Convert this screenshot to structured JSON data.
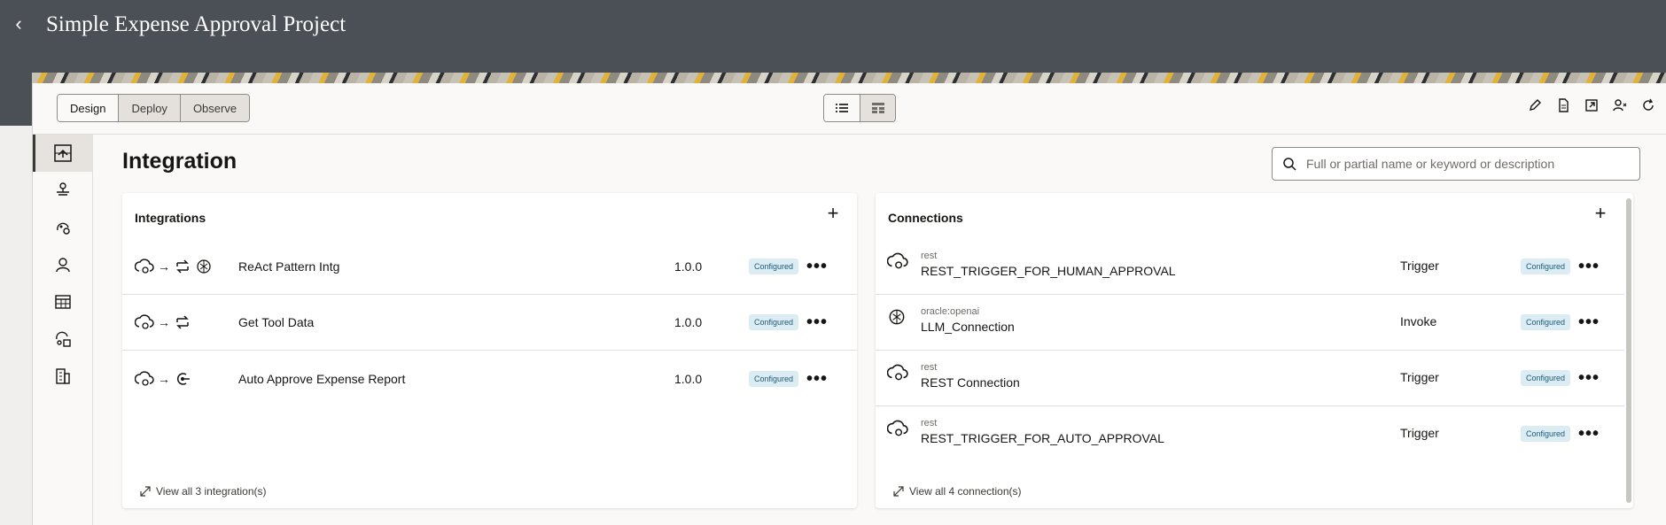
{
  "header": {
    "title": "Simple Expense Approval Project",
    "back_label": "‹"
  },
  "toolbar": {
    "modes": [
      "Design",
      "Deploy",
      "Observe"
    ],
    "active_mode": "Design",
    "view_icons": [
      "list-view-icon",
      "grid-view-icon"
    ],
    "actions": [
      "edit-icon",
      "document-icon",
      "export-icon",
      "share-icon",
      "refresh-icon"
    ]
  },
  "rail": {
    "items": [
      "integration-icon",
      "deploy-icon",
      "agent-icon",
      "user-icon",
      "table-icon",
      "tool-icon",
      "building-icon"
    ]
  },
  "main": {
    "title": "Integration",
    "search_placeholder": "Full or partial name or keyword or description"
  },
  "integrations": {
    "title": "Integrations",
    "add_label": "+",
    "rows": [
      {
        "name": "ReAct Pattern Intg",
        "version": "1.0.0",
        "status": "Configured"
      },
      {
        "name": "Get Tool Data",
        "version": "1.0.0",
        "status": "Configured"
      },
      {
        "name": "Auto Approve Expense Report",
        "version": "1.0.0",
        "status": "Configured"
      }
    ],
    "view_all": "View all 3 integration(s)",
    "more_label": "•••"
  },
  "connections": {
    "title": "Connections",
    "add_label": "+",
    "rows": [
      {
        "type": "rest",
        "name": "REST_TRIGGER_FOR_HUMAN_APPROVAL",
        "role": "Trigger",
        "status": "Configured"
      },
      {
        "type": "oracle:openai",
        "name": "LLM_Connection",
        "role": "Invoke",
        "status": "Configured"
      },
      {
        "type": "rest",
        "name": "REST Connection",
        "role": "Trigger",
        "status": "Configured"
      },
      {
        "type": "rest",
        "name": "REST_TRIGGER_FOR_AUTO_APPROVAL",
        "role": "Trigger",
        "status": "Configured"
      }
    ],
    "view_all": "View all 4 connection(s)",
    "more_label": "•••"
  }
}
